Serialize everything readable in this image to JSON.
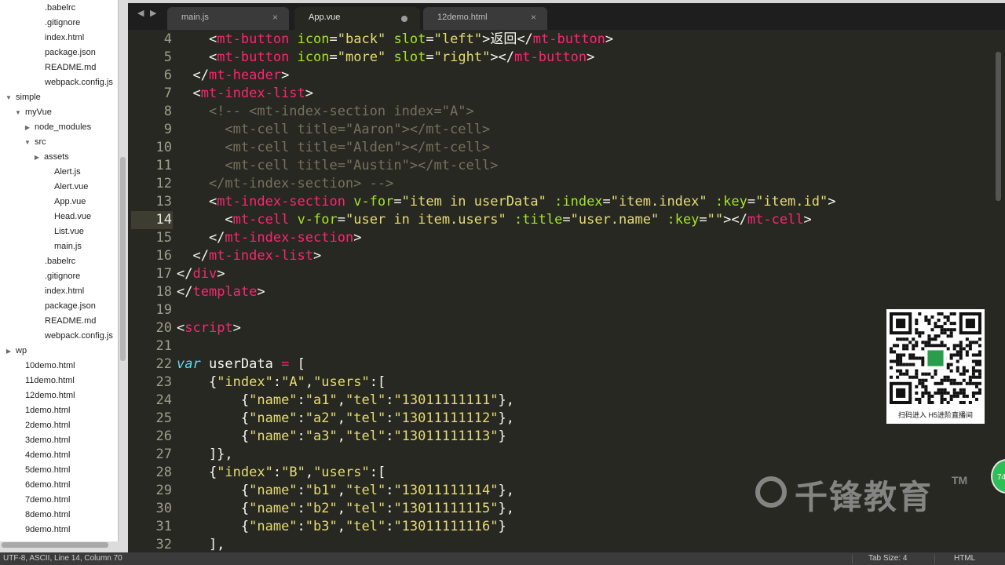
{
  "sidebar": {
    "items": [
      {
        "label": ".babelrc",
        "type": "file"
      },
      {
        "label": ".gitignore",
        "type": "file"
      },
      {
        "label": "index.html",
        "type": "file"
      },
      {
        "label": "package.json",
        "type": "file"
      },
      {
        "label": "README.md",
        "type": "file"
      },
      {
        "label": "webpack.config.js",
        "type": "file"
      },
      {
        "label": "simple",
        "type": "folder-open"
      },
      {
        "label": "myVue",
        "type": "folder-open"
      },
      {
        "label": "node_modules",
        "type": "folder-closed"
      },
      {
        "label": "src",
        "type": "folder-open"
      },
      {
        "label": "assets",
        "type": "folder-closed"
      },
      {
        "label": "Alert.js",
        "type": "file"
      },
      {
        "label": "Alert.vue",
        "type": "file"
      },
      {
        "label": "App.vue",
        "type": "file"
      },
      {
        "label": "Head.vue",
        "type": "file"
      },
      {
        "label": "List.vue",
        "type": "file"
      },
      {
        "label": "main.js",
        "type": "file"
      },
      {
        "label": ".babelrc",
        "type": "file"
      },
      {
        "label": ".gitignore",
        "type": "file"
      },
      {
        "label": "index.html",
        "type": "file"
      },
      {
        "label": "package.json",
        "type": "file"
      },
      {
        "label": "README.md",
        "type": "file"
      },
      {
        "label": "webpack.config.js",
        "type": "file"
      },
      {
        "label": "wp",
        "type": "folder-closed"
      },
      {
        "label": "10demo.html",
        "type": "file"
      },
      {
        "label": "11demo.html",
        "type": "file"
      },
      {
        "label": "12demo.html",
        "type": "file"
      },
      {
        "label": "1demo.html",
        "type": "file"
      },
      {
        "label": "2demo.html",
        "type": "file"
      },
      {
        "label": "3demo.html",
        "type": "file"
      },
      {
        "label": "4demo.html",
        "type": "file"
      },
      {
        "label": "5demo.html",
        "type": "file"
      },
      {
        "label": "6demo.html",
        "type": "file"
      },
      {
        "label": "7demo.html",
        "type": "file"
      },
      {
        "label": "8demo.html",
        "type": "file"
      },
      {
        "label": "9demo.html",
        "type": "file"
      }
    ]
  },
  "tabs": [
    {
      "label": "main.js",
      "state": "close"
    },
    {
      "label": "App.vue",
      "state": "modified"
    },
    {
      "label": "12demo.html",
      "state": "close"
    }
  ],
  "nav": {
    "back": "◀",
    "forward": "▶"
  },
  "editor": {
    "current_line": "14",
    "lines": [
      {
        "n": "4",
        "segs": [
          [
            "    ",
            "p"
          ],
          [
            "<",
            "p"
          ],
          [
            "mt-button",
            "t"
          ],
          [
            " ",
            "p"
          ],
          [
            "icon",
            "a"
          ],
          [
            "=",
            "p"
          ],
          [
            "\"back\"",
            "s"
          ],
          [
            " ",
            "p"
          ],
          [
            "slot",
            "a"
          ],
          [
            "=",
            "p"
          ],
          [
            "\"left\"",
            "s"
          ],
          [
            ">返回</",
            "p"
          ],
          [
            "mt-button",
            "t"
          ],
          [
            ">",
            "p"
          ]
        ]
      },
      {
        "n": "5",
        "segs": [
          [
            "    ",
            "p"
          ],
          [
            "<",
            "p"
          ],
          [
            "mt-button",
            "t"
          ],
          [
            " ",
            "p"
          ],
          [
            "icon",
            "a"
          ],
          [
            "=",
            "p"
          ],
          [
            "\"more\"",
            "s"
          ],
          [
            " ",
            "p"
          ],
          [
            "slot",
            "a"
          ],
          [
            "=",
            "p"
          ],
          [
            "\"right\"",
            "s"
          ],
          [
            "></",
            "p"
          ],
          [
            "mt-button",
            "t"
          ],
          [
            ">",
            "p"
          ]
        ]
      },
      {
        "n": "6",
        "segs": [
          [
            "  </",
            "p"
          ],
          [
            "mt-header",
            "t"
          ],
          [
            ">",
            "p"
          ]
        ]
      },
      {
        "n": "7",
        "segs": [
          [
            "  <",
            "p"
          ],
          [
            "mt-index-list",
            "t"
          ],
          [
            ">",
            "p"
          ]
        ]
      },
      {
        "n": "8",
        "segs": [
          [
            "    <!-- <mt-index-section index=\"A\">",
            "c"
          ]
        ]
      },
      {
        "n": "9",
        "segs": [
          [
            "      <mt-cell title=\"Aaron\"></mt-cell>",
            "c"
          ]
        ]
      },
      {
        "n": "10",
        "segs": [
          [
            "      <mt-cell title=\"Alden\"></mt-cell>",
            "c"
          ]
        ]
      },
      {
        "n": "11",
        "segs": [
          [
            "      <mt-cell title=\"Austin\"></mt-cell>",
            "c"
          ]
        ]
      },
      {
        "n": "12",
        "segs": [
          [
            "    </mt-index-section> -->",
            "c"
          ]
        ]
      },
      {
        "n": "13",
        "segs": [
          [
            "    <",
            "p"
          ],
          [
            "mt-index-section",
            "t"
          ],
          [
            " ",
            "p"
          ],
          [
            "v-for",
            "a"
          ],
          [
            "=",
            "p"
          ],
          [
            "\"item in userData\"",
            "s"
          ],
          [
            " ",
            "p"
          ],
          [
            ":index",
            "a"
          ],
          [
            "=",
            "p"
          ],
          [
            "\"item.index\"",
            "s"
          ],
          [
            " ",
            "p"
          ],
          [
            ":key",
            "a"
          ],
          [
            "=",
            "p"
          ],
          [
            "\"item.id\"",
            "s"
          ],
          [
            ">",
            "p"
          ]
        ]
      },
      {
        "n": "14",
        "segs": [
          [
            "      <",
            "p"
          ],
          [
            "mt-cell",
            "t"
          ],
          [
            " ",
            "p"
          ],
          [
            "v-for",
            "a"
          ],
          [
            "=",
            "p"
          ],
          [
            "\"user in item.users\"",
            "s"
          ],
          [
            " ",
            "p"
          ],
          [
            ":title",
            "a"
          ],
          [
            "=",
            "p"
          ],
          [
            "\"user.name\"",
            "s"
          ],
          [
            " ",
            "p"
          ],
          [
            ":key",
            "a"
          ],
          [
            "=",
            "p"
          ],
          [
            "\"\"",
            "s"
          ],
          [
            "></",
            "p"
          ],
          [
            "mt-cell",
            "t"
          ],
          [
            ">",
            "p"
          ]
        ]
      },
      {
        "n": "15",
        "segs": [
          [
            "    </",
            "p"
          ],
          [
            "mt-index-section",
            "t"
          ],
          [
            ">",
            "p"
          ]
        ]
      },
      {
        "n": "16",
        "segs": [
          [
            "  </",
            "p"
          ],
          [
            "mt-index-list",
            "t"
          ],
          [
            ">",
            "p"
          ]
        ]
      },
      {
        "n": "17",
        "segs": [
          [
            "</",
            "p"
          ],
          [
            "div",
            "t"
          ],
          [
            ">",
            "p"
          ]
        ]
      },
      {
        "n": "18",
        "segs": [
          [
            "</",
            "p"
          ],
          [
            "template",
            "t"
          ],
          [
            ">",
            "p"
          ]
        ]
      },
      {
        "n": "19",
        "segs": []
      },
      {
        "n": "20",
        "segs": [
          [
            "<",
            "p"
          ],
          [
            "script",
            "t"
          ],
          [
            ">",
            "p"
          ]
        ]
      },
      {
        "n": "21",
        "segs": []
      },
      {
        "n": "22",
        "segs": [
          [
            "var",
            "k"
          ],
          [
            " userData ",
            "p"
          ],
          [
            "=",
            "o"
          ],
          [
            " [",
            "p"
          ]
        ]
      },
      {
        "n": "23",
        "segs": [
          [
            "    {",
            "p"
          ],
          [
            "\"index\"",
            "s"
          ],
          [
            ":",
            "p"
          ],
          [
            "\"A\"",
            "s"
          ],
          [
            ",",
            "p"
          ],
          [
            "\"users\"",
            "s"
          ],
          [
            ":[",
            "p"
          ]
        ]
      },
      {
        "n": "24",
        "segs": [
          [
            "        {",
            "p"
          ],
          [
            "\"name\"",
            "s"
          ],
          [
            ":",
            "p"
          ],
          [
            "\"a1\"",
            "s"
          ],
          [
            ",",
            "p"
          ],
          [
            "\"tel\"",
            "s"
          ],
          [
            ":",
            "p"
          ],
          [
            "\"13011111111\"",
            "s"
          ],
          [
            "},",
            "p"
          ]
        ]
      },
      {
        "n": "25",
        "segs": [
          [
            "        {",
            "p"
          ],
          [
            "\"name\"",
            "s"
          ],
          [
            ":",
            "p"
          ],
          [
            "\"a2\"",
            "s"
          ],
          [
            ",",
            "p"
          ],
          [
            "\"tel\"",
            "s"
          ],
          [
            ":",
            "p"
          ],
          [
            "\"13011111112\"",
            "s"
          ],
          [
            "},",
            "p"
          ]
        ]
      },
      {
        "n": "26",
        "segs": [
          [
            "        {",
            "p"
          ],
          [
            "\"name\"",
            "s"
          ],
          [
            ":",
            "p"
          ],
          [
            "\"a3\"",
            "s"
          ],
          [
            ",",
            "p"
          ],
          [
            "\"tel\"",
            "s"
          ],
          [
            ":",
            "p"
          ],
          [
            "\"13011111113\"",
            "s"
          ],
          [
            "}",
            "p"
          ]
        ]
      },
      {
        "n": "27",
        "segs": [
          [
            "    ]},",
            "p"
          ]
        ]
      },
      {
        "n": "28",
        "segs": [
          [
            "    {",
            "p"
          ],
          [
            "\"index\"",
            "s"
          ],
          [
            ":",
            "p"
          ],
          [
            "\"B\"",
            "s"
          ],
          [
            ",",
            "p"
          ],
          [
            "\"users\"",
            "s"
          ],
          [
            ":[",
            "p"
          ]
        ]
      },
      {
        "n": "29",
        "segs": [
          [
            "        {",
            "p"
          ],
          [
            "\"name\"",
            "s"
          ],
          [
            ":",
            "p"
          ],
          [
            "\"b1\"",
            "s"
          ],
          [
            ",",
            "p"
          ],
          [
            "\"tel\"",
            "s"
          ],
          [
            ":",
            "p"
          ],
          [
            "\"13011111114\"",
            "s"
          ],
          [
            "},",
            "p"
          ]
        ]
      },
      {
        "n": "30",
        "segs": [
          [
            "        {",
            "p"
          ],
          [
            "\"name\"",
            "s"
          ],
          [
            ":",
            "p"
          ],
          [
            "\"b2\"",
            "s"
          ],
          [
            ",",
            "p"
          ],
          [
            "\"tel\"",
            "s"
          ],
          [
            ":",
            "p"
          ],
          [
            "\"13011111115\"",
            "s"
          ],
          [
            "},",
            "p"
          ]
        ]
      },
      {
        "n": "31",
        "segs": [
          [
            "        {",
            "p"
          ],
          [
            "\"name\"",
            "s"
          ],
          [
            ":",
            "p"
          ],
          [
            "\"b3\"",
            "s"
          ],
          [
            ",",
            "p"
          ],
          [
            "\"tel\"",
            "s"
          ],
          [
            ":",
            "p"
          ],
          [
            "\"13011111116\"",
            "s"
          ],
          [
            "}",
            "p"
          ]
        ]
      },
      {
        "n": "32",
        "segs": [
          [
            "    ],",
            "p"
          ]
        ]
      }
    ]
  },
  "status": {
    "left": "UTF-8, ASCII, Line 14, Column 70",
    "tab_size": "Tab Size: 4",
    "syntax": "HTML"
  },
  "qr": {
    "caption": "扫码进入 H5进阶直播间"
  },
  "watermark": {
    "text": "千锋教育",
    "tm": "TM",
    "badge": "74"
  },
  "colors": {
    "tag": "#f92672",
    "attr": "#a6e22e",
    "string": "#e6db74",
    "comment": "#75715e",
    "keyword": "#66d9ef",
    "background": "#272822"
  }
}
